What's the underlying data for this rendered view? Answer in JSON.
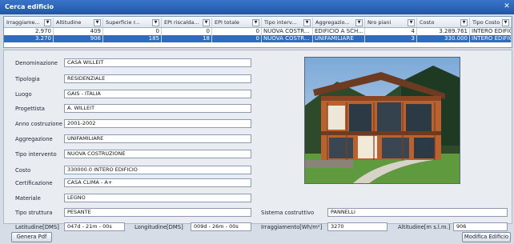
{
  "window": {
    "title": "Cerca edificio",
    "close_icon": "close-icon"
  },
  "grid": {
    "columns": [
      "Irraggiame...",
      "Altitudine",
      "Superficie r...",
      "EPI riscalda...",
      "EPI totale",
      "Tipo interv...",
      "Aggregazio...",
      "Nro piani",
      "Costo",
      "Tipo Costo"
    ],
    "rows": [
      [
        "2.970",
        "409",
        "0",
        "0",
        "0",
        "NUOVA COSTR...",
        "EDIFICIO A SCH...",
        "4",
        "3.289.761",
        "INTERO EDIFICIO"
      ],
      [
        "3.270",
        "906",
        "185",
        "18",
        "0",
        "NUOVA COSTR...",
        "UNIFAMILIARE",
        "3",
        "330.000",
        "INTERO EDIFICIO"
      ]
    ],
    "selected_row": 1
  },
  "form": {
    "denominazione": {
      "label": "Denominazione",
      "value": "CASA WILLEIT"
    },
    "tipologia": {
      "label": "Tipologia",
      "value": "RESIDENZIALE"
    },
    "luogo": {
      "label": "Luogo",
      "value": "GAIS - ITALIA"
    },
    "progettista": {
      "label": "Progettista",
      "value": "A. WILLEIT"
    },
    "anno": {
      "label": "Anno costruzione",
      "value": "2001-2002"
    },
    "aggregazione": {
      "label": "Aggregazione",
      "value": "UNIFAMILIARE"
    },
    "tipo_intervento": {
      "label": "Tipo intervento",
      "value": "NUOVA COSTRUZIONE"
    },
    "costo": {
      "label": "Costo",
      "value": "330000.0 INTERO EDIFICIO"
    },
    "certificazione": {
      "label": "Certificazione",
      "value": "CASA CLIMA - A+"
    },
    "materiale": {
      "label": "Materiale",
      "value": "LEGNO"
    },
    "tipo_struttura": {
      "label": "Tipo struttura",
      "value": "PESANTE"
    },
    "sistema": {
      "label": "Sistema costruttivo",
      "value": "PANNELLI"
    },
    "latitudine": {
      "label": "Latitudine[DMS]",
      "value": "047d - 21m - 00s"
    },
    "longitudine": {
      "label": "Longitudine[DMS]",
      "value": "009d - 26m - 00s"
    },
    "irraggiamento": {
      "label": "Irraggiamento[Wh/m²]",
      "value": "3270"
    },
    "altitudine": {
      "label": "Altitudine[m s.l.m.]",
      "value": "906"
    }
  },
  "buttons": {
    "genera_pdf": "Genera Pdf",
    "modifica": "Modifica Edificio"
  },
  "photo": {
    "icon": "building-photo"
  },
  "colors": {
    "accent": "#1f56a8",
    "selected_row": "#2f6bbf"
  }
}
